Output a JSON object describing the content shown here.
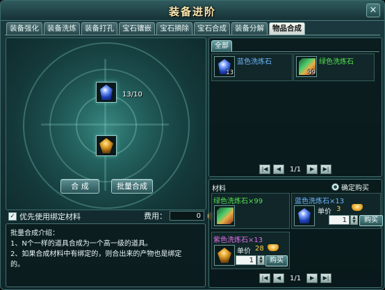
{
  "window": {
    "title": "装备进阶"
  },
  "tabs": [
    "装备强化",
    "装备洗炼",
    "装备打孔",
    "宝石镶嵌",
    "宝石摘除",
    "宝石合成",
    "装备分解",
    "物品合成"
  ],
  "active_tab": 7,
  "compose": {
    "input_count": "13/10",
    "merge_button": "合 成",
    "batch_button": "批量合成",
    "use_bound_label": "优先使用绑定材料",
    "fee_label": "费用：",
    "fee_value": "0"
  },
  "help": {
    "title": "批量合成介绍：",
    "line1": "1、N个一样的道具合成为一个高一级的道具。",
    "line2": "2、如果合成材料中有绑定的，则合出来的产物也是绑定",
    "line3": "的。"
  },
  "recipes": {
    "category_tab": "全部",
    "items": [
      {
        "name": "蓝色洗炼石",
        "count": "13",
        "color": "#6fb7ff"
      },
      {
        "name": "绿色洗炼石",
        "count": "99",
        "color": "#55e04f"
      }
    ],
    "page": "1/1"
  },
  "materials": {
    "label": "材料",
    "confirm_buy": "确定购买",
    "green_stone": {
      "name": "绿色洗炼石×99",
      "color": "#55e04f"
    },
    "blue_stone": {
      "name": "蓝色洗炼石×13",
      "color": "#6fb7ff",
      "price_label": "单价",
      "price": "3",
      "qty": "1",
      "buy": "购买"
    },
    "purple_stone": {
      "name": "紫色洗炼石×13",
      "color": "#e06fe8",
      "price_label": "单价",
      "price": "28",
      "qty": "1",
      "buy": "购买"
    },
    "page": "1/1"
  },
  "colors": {
    "price": "#ffd34a",
    "title": "#ffe9b0"
  }
}
